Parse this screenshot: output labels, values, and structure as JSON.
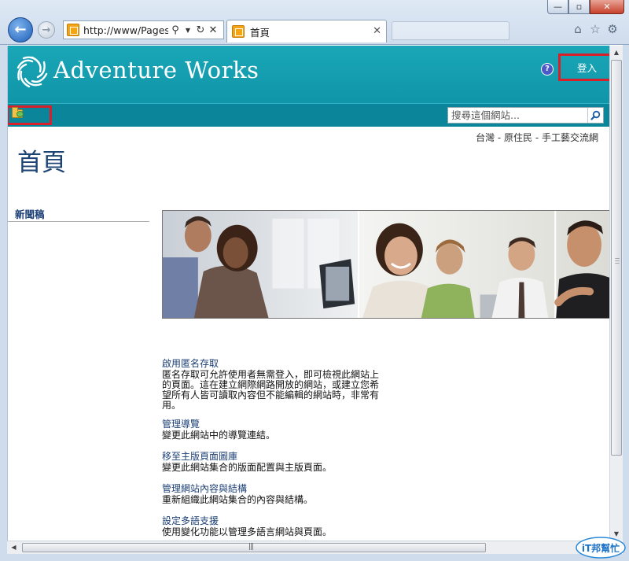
{
  "browser": {
    "address": "http://www/Pages/",
    "tab_label": "首頁",
    "window_controls": [
      "—",
      "▫",
      "✕"
    ]
  },
  "site": {
    "title": "Adventure Works",
    "signin_label": "登入",
    "help_symbol": "?",
    "search_placeholder": "搜尋這個網站..."
  },
  "breadcrumb": "台灣 - 原住民 - 手工藝交流網",
  "page_title": "首頁",
  "quick_launch": {
    "heading": "新聞稿"
  },
  "links": [
    {
      "title": "啟用匿名存取",
      "desc": [
        "匿名存取可允許使用者無需登入，即可檢視此網站上",
        "的頁面。這在建立網際網路開放的網站，或建立您希",
        "望所有人皆可讀取內容但不能編輯的網站時，非常有",
        "用。"
      ]
    },
    {
      "title": "管理導覽",
      "desc": [
        "變更此網站中的導覽連結。"
      ]
    },
    {
      "title": "移至主版頁面圖庫",
      "desc": [
        "變更此網站集合的版面配置與主版頁面。"
      ]
    },
    {
      "title": "管理網站內容與結構",
      "desc": [
        "重新組織此網站集合的內容與結構。"
      ]
    },
    {
      "title": "設定多語支援",
      "desc": [
        "使用變化功能以管理多語言網站與頁面。"
      ]
    }
  ],
  "colors": {
    "header_teal": "#0b8ea1",
    "highlight_red": "#d8202a",
    "link_blue": "#1c3f75"
  },
  "watermark": "iT邦幫忙"
}
